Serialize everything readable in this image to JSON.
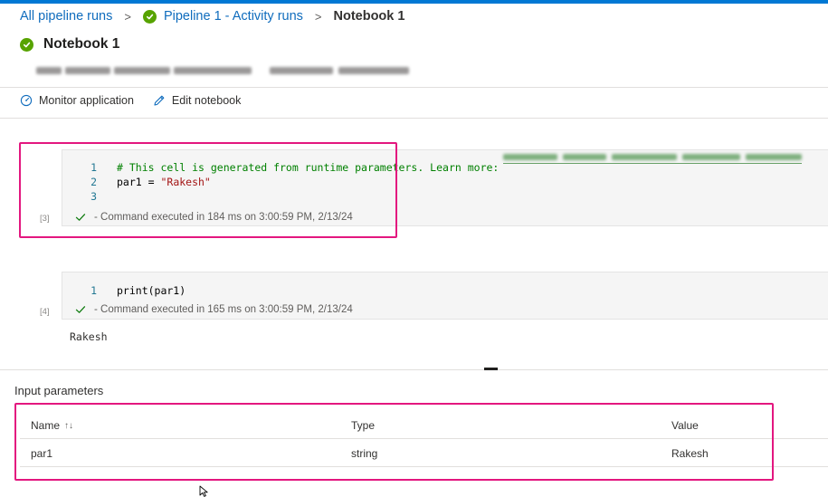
{
  "breadcrumb": {
    "root": "All pipeline runs",
    "pipeline": "Pipeline 1 - Activity runs",
    "current": "Notebook 1",
    "separator": ">"
  },
  "header": {
    "title": "Notebook 1",
    "status_color": "#57a300"
  },
  "toolbar": {
    "monitor_label": "Monitor application",
    "edit_label": "Edit notebook"
  },
  "cells": [
    {
      "exec_count": "[3]",
      "lines": [
        {
          "num": "1",
          "comment": "# This cell is generated from runtime parameters. Learn more:"
        },
        {
          "num": "2",
          "var": "par1 = ",
          "str": "\"Rakesh\""
        },
        {
          "num": "3"
        }
      ],
      "status": "- Command executed in 184 ms on 3:00:59 PM, 2/13/24"
    },
    {
      "exec_count": "[4]",
      "lines": [
        {
          "num": "1",
          "code": "print(par1)"
        }
      ],
      "status": "- Command executed in 165 ms on 3:00:59 PM, 2/13/24",
      "output": "Rakesh"
    }
  ],
  "input_parameters": {
    "title": "Input parameters",
    "columns": [
      "Name",
      "Type",
      "Value"
    ],
    "sort_indicator": "↑↓",
    "rows": [
      {
        "name": "par1",
        "type": "string",
        "value": "Rakesh"
      }
    ]
  },
  "colors": {
    "accent": "#0078d4",
    "link": "#0f6cbd",
    "highlight": "#e3177f",
    "success": "#57a300"
  }
}
